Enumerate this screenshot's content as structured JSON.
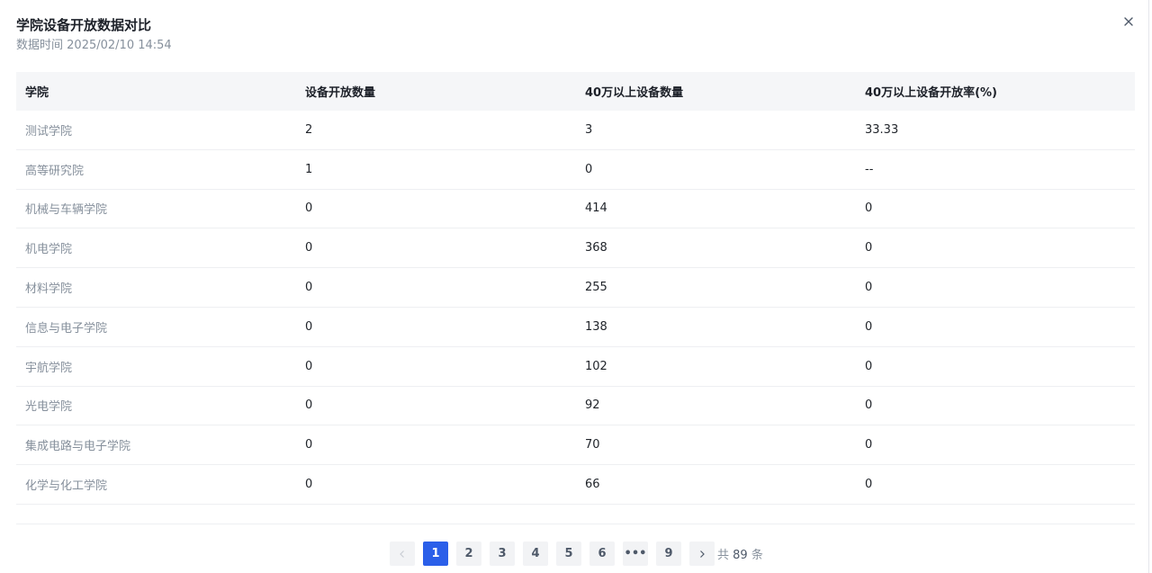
{
  "dialog": {
    "title": "学院设备开放数据对比",
    "time_label": "数据时间",
    "time_value": "2025/02/10 14:54"
  },
  "table": {
    "headers": [
      "学院",
      "设备开放数量",
      "40万以上设备数量",
      "40万以上设备开放率(%)"
    ],
    "rows": [
      [
        "测试学院",
        "2",
        "3",
        "33.33"
      ],
      [
        "高等研究院",
        "1",
        "0",
        "--"
      ],
      [
        "机械与车辆学院",
        "0",
        "414",
        "0"
      ],
      [
        "机电学院",
        "0",
        "368",
        "0"
      ],
      [
        "材料学院",
        "0",
        "255",
        "0"
      ],
      [
        "信息与电子学院",
        "0",
        "138",
        "0"
      ],
      [
        "宇航学院",
        "0",
        "102",
        "0"
      ],
      [
        "光电学院",
        "0",
        "92",
        "0"
      ],
      [
        "集成电路与电子学院",
        "0",
        "70",
        "0"
      ],
      [
        "化学与化工学院",
        "0",
        "66",
        "0"
      ]
    ]
  },
  "pagination": {
    "pages": [
      "1",
      "2",
      "3",
      "4",
      "5",
      "6",
      "•••",
      "9"
    ],
    "current": "1",
    "total_prefix": "共",
    "total_count": "89",
    "total_suffix": "条"
  },
  "icons": {
    "close": "close-icon",
    "prev": "chevron-left-icon",
    "next": "chevron-right-icon"
  },
  "colors": {
    "accent": "#2b5fe9",
    "header_bg": "#f5f6f8",
    "muted_text": "#86909c"
  }
}
